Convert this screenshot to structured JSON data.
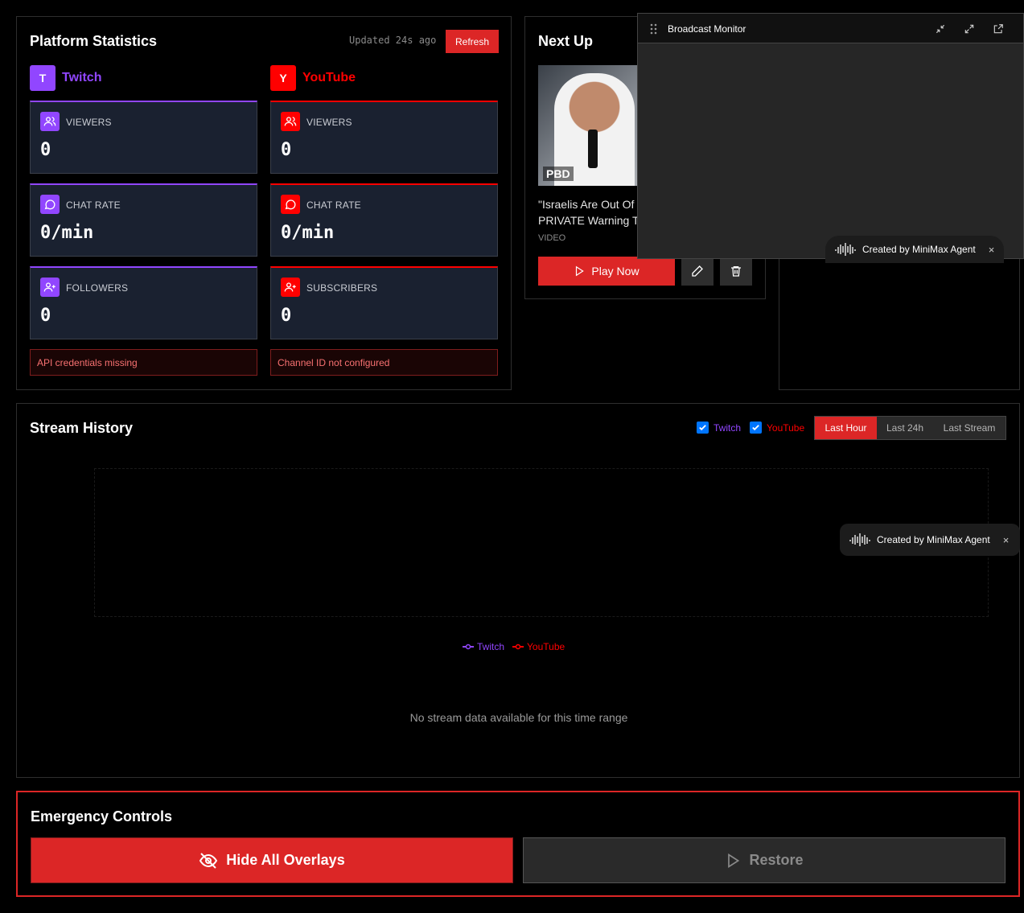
{
  "stats": {
    "title": "Platform Statistics",
    "updated": "Updated 24s ago",
    "refresh_label": "Refresh",
    "twitch": {
      "badge": "T",
      "name": "Twitch",
      "color": "#9146ff",
      "cards": [
        {
          "label": "VIEWERS",
          "value": "0",
          "icon": "users-icon"
        },
        {
          "label": "CHAT RATE",
          "value": "0/min",
          "icon": "chat-icon"
        },
        {
          "label": "FOLLOWERS",
          "value": "0",
          "icon": "user-plus-icon"
        }
      ],
      "error": "API credentials missing"
    },
    "youtube": {
      "badge": "Y",
      "name": "YouTube",
      "color": "#ff0000",
      "cards": [
        {
          "label": "VIEWERS",
          "value": "0",
          "icon": "users-icon"
        },
        {
          "label": "CHAT RATE",
          "value": "0/min",
          "icon": "chat-icon"
        },
        {
          "label": "SUBSCRIBERS",
          "value": "0",
          "icon": "user-plus-icon"
        }
      ],
      "error": "Channel ID not configured"
    }
  },
  "next_up": {
    "title": "Next Up",
    "thumb_logo": "PBD",
    "item_title": "\"Israelis Are Out Of C\nPRIVATE Warning To",
    "item_type": "VIDEO",
    "play_label": "Play Now"
  },
  "monitor": {
    "title": "Broadcast Monitor"
  },
  "minimax": {
    "label": "Created by MiniMax Agent",
    "close": "×"
  },
  "history": {
    "title": "Stream History",
    "filters": [
      {
        "label": "Twitch",
        "checked": true,
        "color": "#9146ff"
      },
      {
        "label": "YouTube",
        "checked": true,
        "color": "#ff0000"
      }
    ],
    "ranges": [
      "Last Hour",
      "Last 24h",
      "Last Stream"
    ],
    "active_range": "Last Hour",
    "legend": [
      "Twitch",
      "YouTube"
    ],
    "empty_text": "No stream data available for this time range"
  },
  "chart_data": {
    "type": "line",
    "series": [
      {
        "name": "Twitch",
        "values": []
      },
      {
        "name": "YouTube",
        "values": []
      }
    ],
    "x": []
  },
  "emergency": {
    "title": "Emergency Controls",
    "hide_label": "Hide All Overlays",
    "restore_label": "Restore"
  }
}
